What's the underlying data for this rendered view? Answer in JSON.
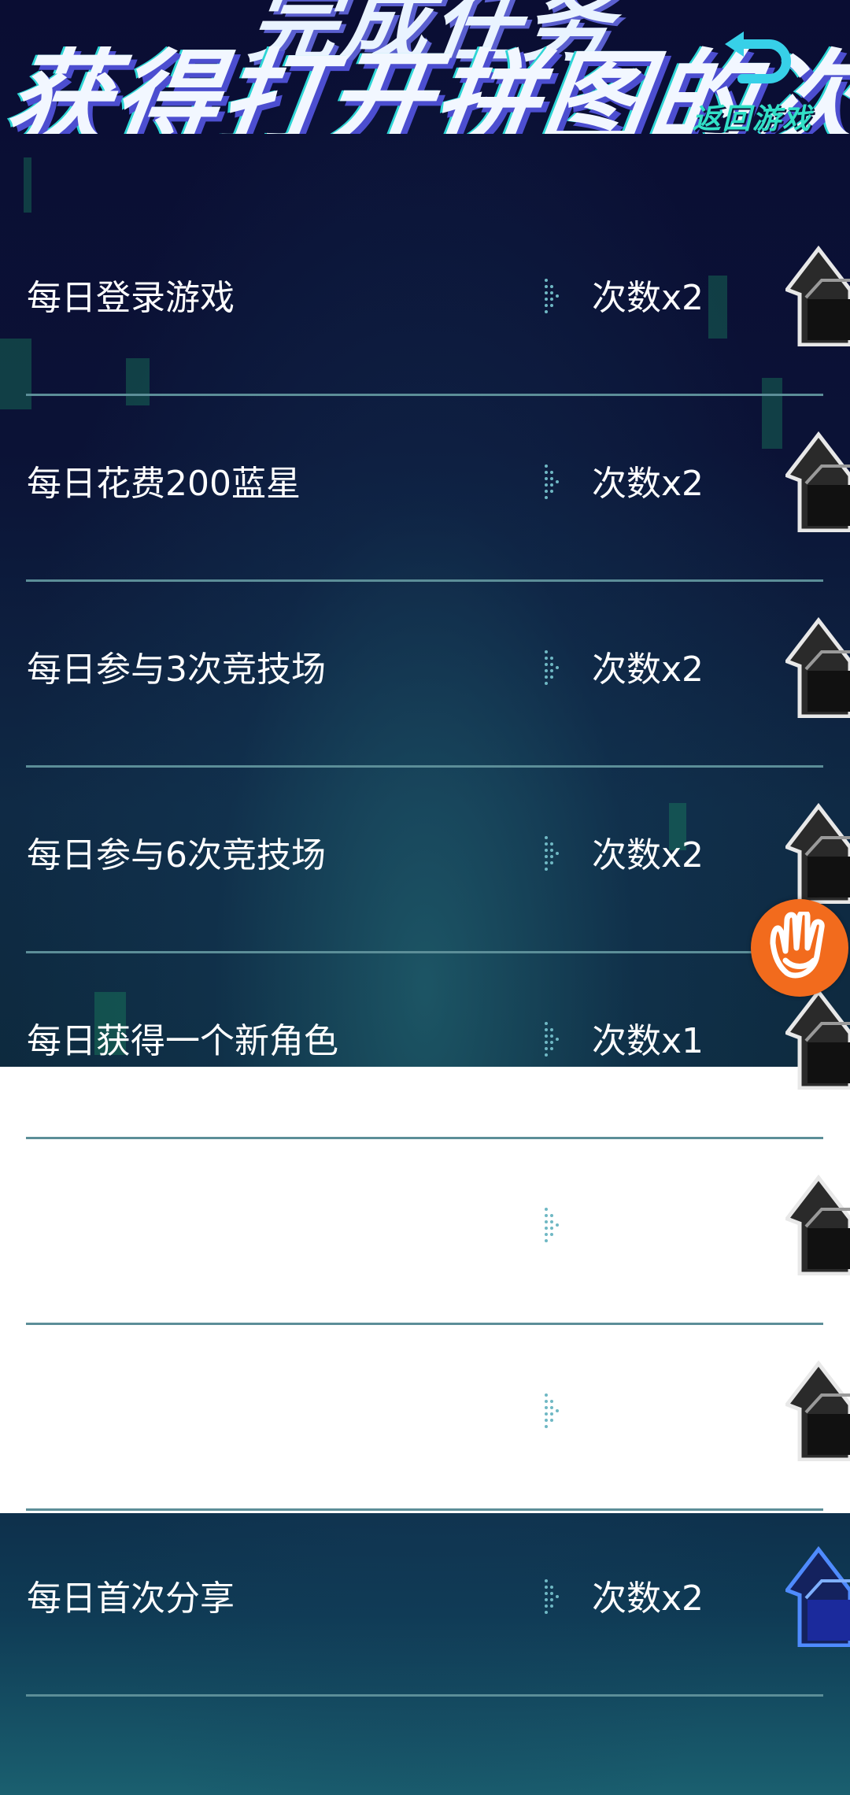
{
  "header": {
    "title_line1": "完成任务",
    "title_line2": "获得打开拼图的次",
    "back_label": "返回游戏"
  },
  "tasks": [
    {
      "label": "每日登录游戏",
      "reward": "次数x2",
      "button": "go-button"
    },
    {
      "label": "每日花费200蓝星",
      "reward": "次数x2",
      "button": "go-button"
    },
    {
      "label": "每日参与3次竞技场",
      "reward": "次数x2",
      "button": "go-button"
    },
    {
      "label": "每日参与6次竞技场",
      "reward": "次数x2",
      "button": "go-button"
    },
    {
      "label": "每日获得一个新角色",
      "reward": "次数x1",
      "button": "go-button"
    },
    {
      "label": "",
      "reward": "",
      "button": "go-button"
    },
    {
      "label": "",
      "reward": "",
      "button": "go-button"
    },
    {
      "label": "每日首次分享",
      "reward": "次数x2",
      "button": "go-button-active"
    }
  ],
  "colors": {
    "text": "#ffffff",
    "divider": "#5c8e98",
    "accent_teal": "#31e0c6",
    "float_button": "#f26b1d",
    "active_button": "#2f6bff"
  },
  "icons": {
    "back": "return-arrow-icon",
    "float": "hand-eye-icon",
    "row_button": "house-arrow-icon",
    "row_separator": "dotted-arrow-icon"
  }
}
